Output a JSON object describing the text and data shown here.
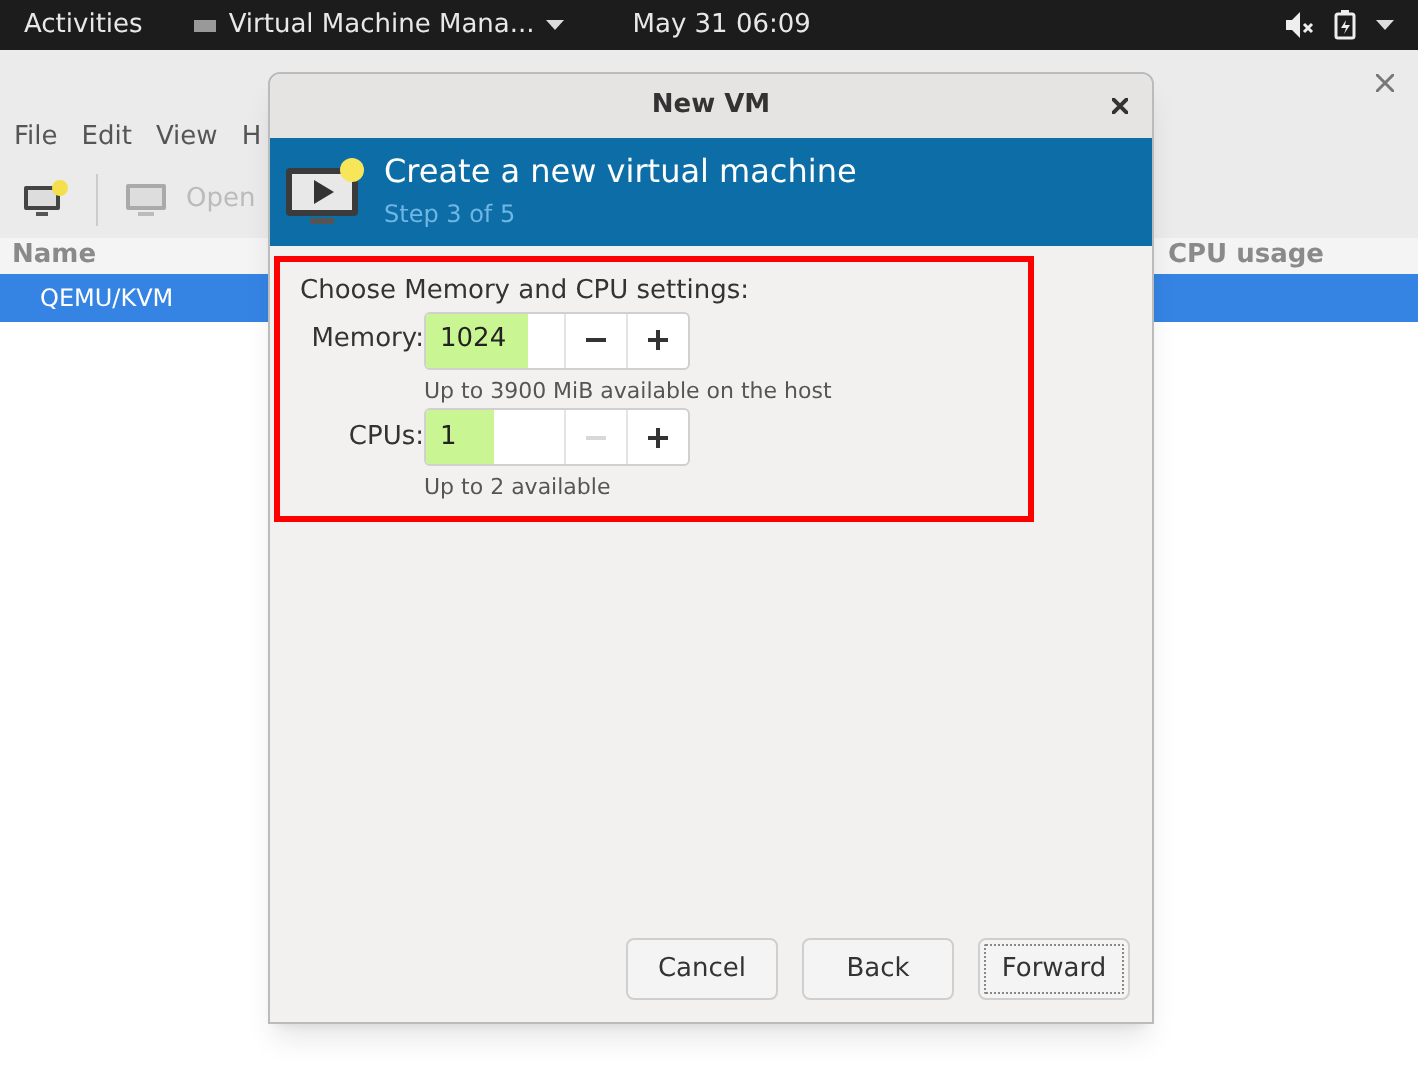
{
  "top_bar": {
    "activities": "Activities",
    "app_menu": "Virtual Machine Mana...",
    "clock": "May 31  06:09"
  },
  "app_window": {
    "menu": [
      "File",
      "Edit",
      "View",
      "H"
    ],
    "toolbar_open": "Open",
    "columns": [
      "Name",
      "CPU usage"
    ],
    "rows": [
      {
        "name": "QEMU/KVM",
        "selected": true
      }
    ]
  },
  "dialog": {
    "title": "New VM",
    "header_title": "Create a new virtual machine",
    "header_step": "Step 3 of 5",
    "section_title": "Choose Memory and CPU settings:",
    "highlighted": true,
    "spinners": [
      {
        "label": "Memory:",
        "value": "1024",
        "hint": "Up to 3900 MiB available on the host",
        "minus_disabled": false,
        "plus_disabled": false
      },
      {
        "label": "CPUs:",
        "value": "1",
        "hint": "Up to 2 available",
        "minus_disabled": true,
        "plus_disabled": false
      }
    ],
    "buttons": [
      {
        "label": "Cancel",
        "focused": false
      },
      {
        "label": "Back",
        "focused": false
      },
      {
        "label": "Forward",
        "focused": true
      }
    ]
  }
}
